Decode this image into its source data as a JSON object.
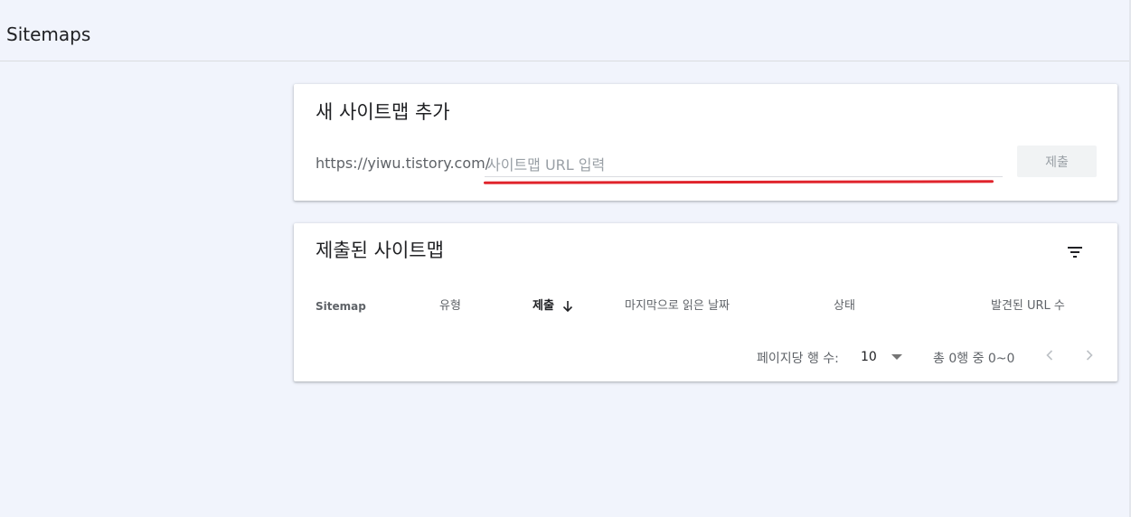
{
  "header": {
    "title": "Sitemaps"
  },
  "add_card": {
    "title": "새 사이트맵 추가",
    "url_prefix": "https://yiwu.tistory.com/",
    "input_value": "",
    "input_placeholder": "사이트맵 URL 입력",
    "submit_label": "제출",
    "annotation_color": "#e0232b"
  },
  "list_card": {
    "title": "제출된 사이트맵",
    "filter_icon": "filter-list-icon",
    "columns": [
      "Sitemap",
      "유형",
      "제출",
      "마지막으로 읽은 날짜",
      "상태",
      "발견된 URL 수"
    ],
    "sorted_column": "제출",
    "sort_direction": "descending",
    "rows": [],
    "pagination": {
      "rows_per_page_label": "페이지당 행 수:",
      "rows_per_page_value": "10",
      "range_text": "총 0행 중 0~0",
      "prev_icon": "chevron-left-icon",
      "next_icon": "chevron-right-icon"
    }
  },
  "colors": {
    "background": "#f1f4fc",
    "card": "#ffffff",
    "muted_text": "#5f6368",
    "disabled_button": "#f1f3f4"
  }
}
